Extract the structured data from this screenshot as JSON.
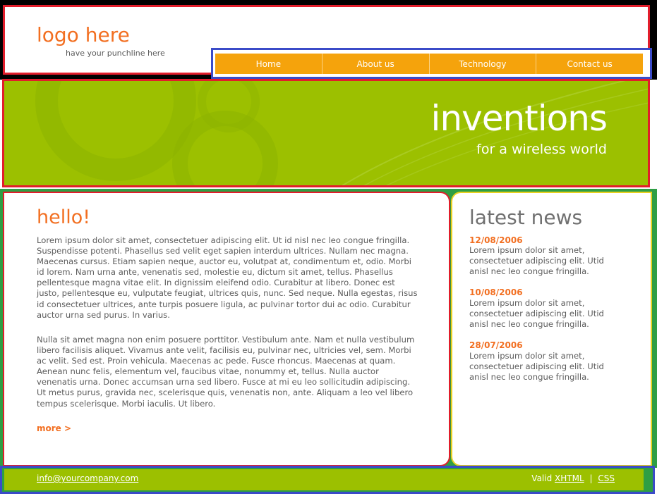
{
  "header": {
    "logo": "logo here",
    "punchline": "have your punchline here",
    "nav": [
      {
        "label": "Home"
      },
      {
        "label": "About us"
      },
      {
        "label": "Technology"
      },
      {
        "label": "Contact us"
      }
    ]
  },
  "banner": {
    "title": "inventions",
    "subtitle": "for a wireless world"
  },
  "main": {
    "title": "hello!",
    "paragraph1": "Lorem ipsum dolor sit amet, consectetuer adipiscing elit. Ut id nisl nec leo congue fringilla. Suspendisse potenti. Phasellus sed velit eget sapien interdum ultrices. Nullam nec magna. Maecenas cursus. Etiam sapien neque, auctor eu, volutpat at, condimentum et, odio. Morbi id lorem. Nam urna ante, venenatis sed, molestie eu, dictum sit amet, tellus. Phasellus pellentesque magna vitae elit. In dignissim eleifend odio. Curabitur at libero. Donec est justo, pellentesque eu, vulputate feugiat, ultrices quis, nunc. Sed neque. Nulla egestas, risus id consectetuer ultrices, ante turpis posuere ligula, ac pulvinar tortor dui ac odio. Curabitur auctor urna sed purus. In varius.",
    "paragraph2": "Nulla sit amet magna non enim posuere porttitor. Vestibulum ante. Nam et nulla vestibulum libero facilisis aliquet. Vivamus ante velit, facilisis eu, pulvinar nec, ultricies vel, sem. Morbi ac velit. Sed est. Proin vehicula. Maecenas ac pede. Fusce rhoncus. Maecenas at quam. Aenean nunc felis, elementum vel, faucibus vitae, nonummy et, tellus. Nulla auctor venenatis urna. Donec accumsan urna sed libero. Fusce at mi eu leo sollicitudin adipiscing. Ut metus purus, gravida nec, scelerisque quis, venenatis non, ante. Aliquam a leo vel libero tempus scelerisque. Morbi iaculis. Ut libero.",
    "more_label": "more >"
  },
  "sidebar": {
    "title": "latest news",
    "news": [
      {
        "date": "12/08/2006",
        "text": "Lorem ipsum dolor sit amet, consectetuer adipiscing elit. Utid anisl nec leo congue fringilla."
      },
      {
        "date": "10/08/2006",
        "text": "Lorem ipsum dolor sit amet, consectetuer adipiscing elit. Utid anisl nec leo congue fringilla."
      },
      {
        "date": "28/07/2006",
        "text": "Lorem ipsum dolor sit amet, consectetuer adipiscing elit. Utid anisl nec leo congue fringilla."
      }
    ]
  },
  "footer": {
    "email": "info@yourcompany.com",
    "valid_label": "Valid",
    "xhtml_label": "XHTML",
    "separator": "|",
    "css_label": "CSS"
  },
  "colors": {
    "accent_orange": "#f26f21",
    "nav_orange": "#f5a30c",
    "brand_green": "#9cc000"
  }
}
